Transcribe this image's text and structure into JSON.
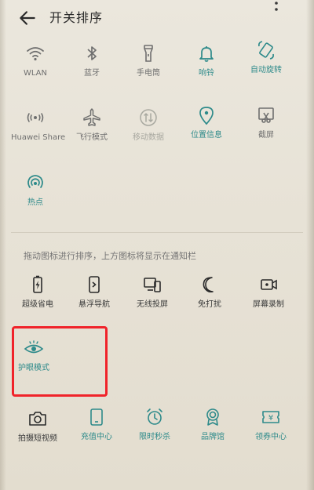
{
  "header": {
    "title": "开关排序"
  },
  "active_tiles": [
    {
      "label": "WLAN",
      "icon": "wifi-icon",
      "state": "off"
    },
    {
      "label": "蓝牙",
      "icon": "bluetooth-icon",
      "state": "off"
    },
    {
      "label": "手电筒",
      "icon": "flashlight-icon",
      "state": "off"
    },
    {
      "label": "响铃",
      "icon": "bell-icon",
      "state": "on"
    },
    {
      "label": "自动旋转",
      "icon": "auto-rotate-icon",
      "state": "on"
    },
    {
      "label": "Huawei Share",
      "icon": "huawei-share-icon",
      "state": "off"
    },
    {
      "label": "飞行模式",
      "icon": "airplane-icon",
      "state": "off"
    },
    {
      "label": "移动数据",
      "icon": "mobile-data-icon",
      "state": "disabled"
    },
    {
      "label": "位置信息",
      "icon": "location-icon",
      "state": "on"
    },
    {
      "label": "截屏",
      "icon": "screenshot-icon",
      "state": "off"
    },
    {
      "label": "热点",
      "icon": "hotspot-icon",
      "state": "on"
    }
  ],
  "hint": "拖动图标进行排序，上方图标将显示在通知栏",
  "more_tiles": [
    {
      "label": "超级省电",
      "icon": "battery-saver-icon",
      "state": "on"
    },
    {
      "label": "悬浮导航",
      "icon": "floating-nav-icon",
      "state": "on"
    },
    {
      "label": "无线投屏",
      "icon": "wireless-projection-icon",
      "state": "on"
    },
    {
      "label": "免打扰",
      "icon": "do-not-disturb-icon",
      "state": "on"
    },
    {
      "label": "屏幕录制",
      "icon": "screen-record-icon",
      "state": "on"
    },
    {
      "label": "护眼模式",
      "icon": "eye-comfort-icon",
      "state": "active",
      "highlighted": true
    },
    {
      "label": "拍摄短视频",
      "icon": "camera-icon",
      "state": "on"
    },
    {
      "label": "充值中心",
      "icon": "recharge-icon",
      "state": "active"
    },
    {
      "label": "限时秒杀",
      "icon": "alarm-clock-icon",
      "state": "active"
    },
    {
      "label": "品牌馆",
      "icon": "brand-icon",
      "state": "active"
    },
    {
      "label": "领券中心",
      "icon": "coupon-icon",
      "state": "active"
    }
  ],
  "colors": {
    "icon_default": "#6f6f6f",
    "icon_active": "#2d8a8a",
    "icon_disabled": "#a8a8a0",
    "highlight": "#f0232a",
    "background": "#e9e5da"
  }
}
